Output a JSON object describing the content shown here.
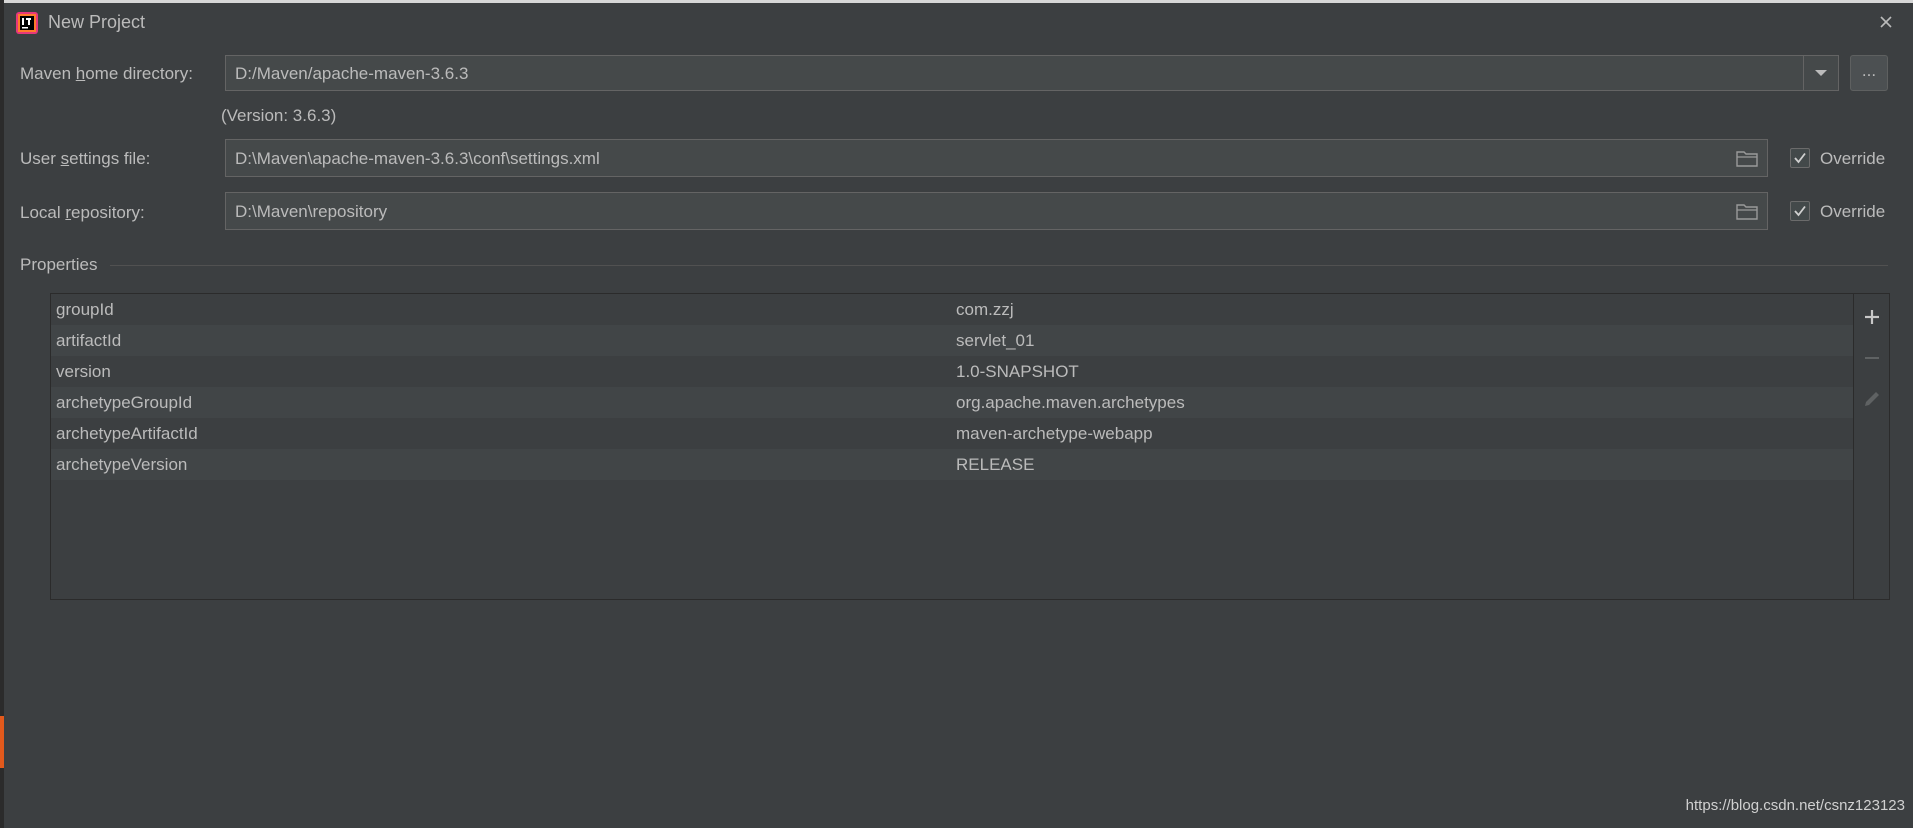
{
  "window": {
    "title": "New Project",
    "icon": "intellij-icon",
    "close_icon": "close-icon"
  },
  "maven_home": {
    "label_pre": "Maven ",
    "label_mnemonic": "h",
    "label_post": "ome directory:",
    "value": "D:/Maven/apache-maven-3.6.3",
    "browse_label": "...",
    "version_text": "(Version: 3.6.3)"
  },
  "user_settings": {
    "label_pre": "User ",
    "label_mnemonic": "s",
    "label_post": "ettings file:",
    "value": "D:\\Maven\\apache-maven-3.6.3\\conf\\settings.xml",
    "override_label": "Override",
    "override_checked": true
  },
  "local_repository": {
    "label_pre": "Local ",
    "label_mnemonic": "r",
    "label_post": "epository:",
    "value": "D:\\Maven\\repository",
    "override_label": "Override",
    "override_checked": true
  },
  "properties": {
    "title": "Properties",
    "rows": [
      {
        "key": "groupId",
        "value": "com.zzj"
      },
      {
        "key": "artifactId",
        "value": "servlet_01"
      },
      {
        "key": "version",
        "value": "1.0-SNAPSHOT"
      },
      {
        "key": "archetypeGroupId",
        "value": "org.apache.maven.archetypes"
      },
      {
        "key": "archetypeArtifactId",
        "value": "maven-archetype-webapp"
      },
      {
        "key": "archetypeVersion",
        "value": "RELEASE"
      }
    ]
  },
  "watermark": "https://blog.csdn.net/csnz123123",
  "colors": {
    "background": "#3c3f41",
    "field": "#45494a",
    "text": "#bbbbbb",
    "accent": "#e2591c"
  }
}
